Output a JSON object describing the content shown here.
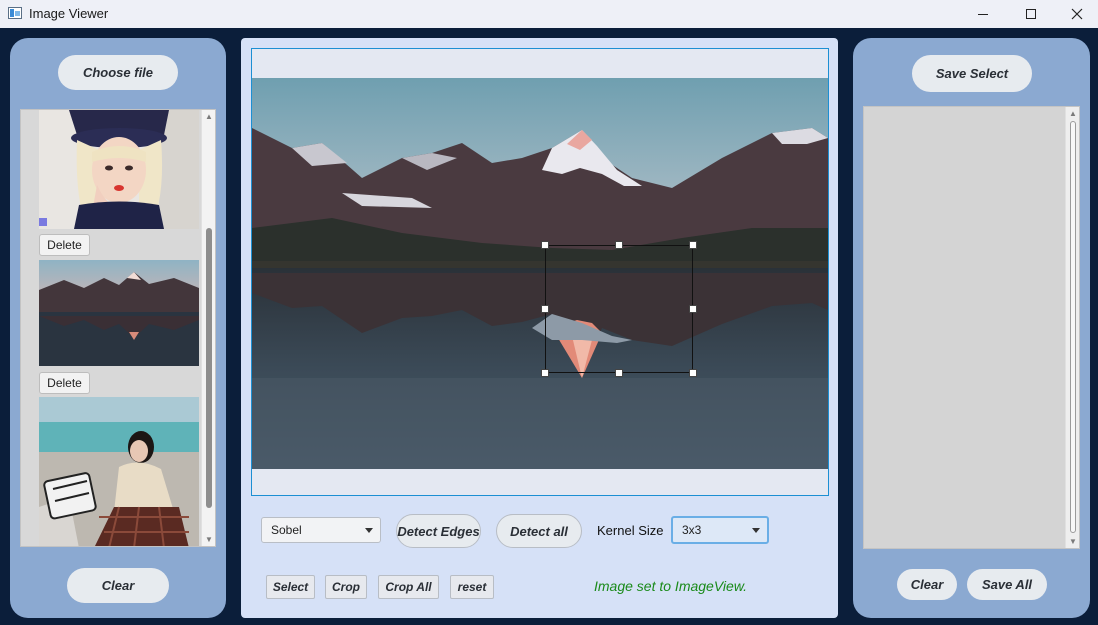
{
  "window": {
    "title": "Image Viewer"
  },
  "left_panel": {
    "choose_file_label": "Choose file",
    "clear_label": "Clear",
    "items": [
      {
        "delete_label": "Delete"
      },
      {
        "delete_label": "Delete"
      }
    ]
  },
  "center_panel": {
    "edge_method_value": "Sobel",
    "detect_edges_label": "Detect Edges",
    "detect_all_label": "Detect all",
    "kernel_size_label": "Kernel Size",
    "kernel_size_value": "3x3",
    "select_label": "Select",
    "crop_label": "Crop",
    "crop_all_label": "Crop All",
    "reset_label": "reset",
    "status_text": "Image set to ImageView."
  },
  "right_panel": {
    "save_select_label": "Save Select",
    "clear_label": "Clear",
    "save_all_label": "Save All"
  },
  "colors": {
    "panel_blue": "#8ba9d1",
    "center_bg": "#d6e1f7",
    "status_green": "#1a8a1a",
    "frame_border": "#1c8fd3"
  }
}
